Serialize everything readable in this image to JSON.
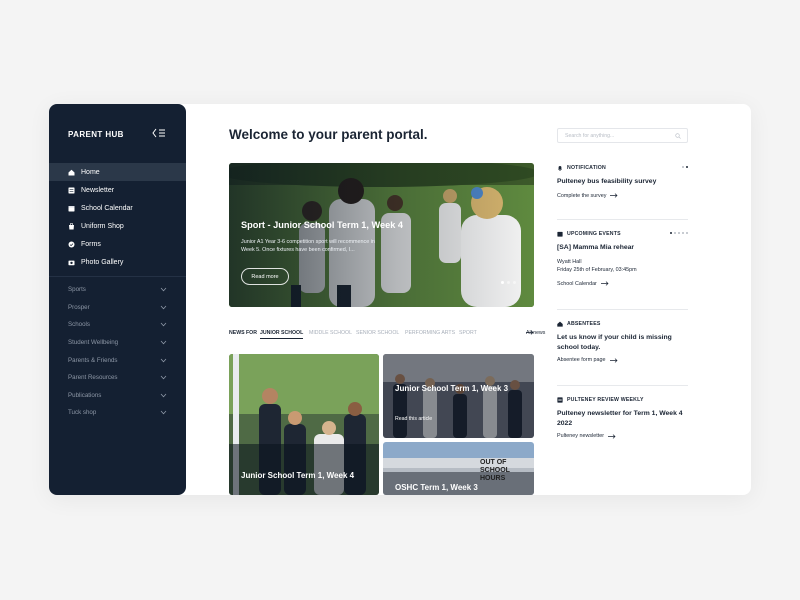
{
  "sidebar": {
    "brand": "PARENT HUB",
    "nav": [
      {
        "label": "Home",
        "icon": "home-icon"
      },
      {
        "label": "Newsletter",
        "icon": "newsletter-icon"
      },
      {
        "label": "School Calendar",
        "icon": "calendar-icon"
      },
      {
        "label": "Uniform Shop",
        "icon": "shop-icon"
      },
      {
        "label": "Forms",
        "icon": "forms-icon"
      },
      {
        "label": "Photo Gallery",
        "icon": "camera-icon"
      }
    ],
    "sections": [
      "Sports",
      "Prosper",
      "Schools",
      "Student Wellbeing",
      "Parents & Friends",
      "Parent Resources",
      "Publications",
      "Tuck shop"
    ]
  },
  "main": {
    "title": "Welcome to your parent portal.",
    "hero": {
      "title": "Sport - Junior School Term 1, Week 4",
      "text": "Junior A1 Year 3-6 competition sport will recommence in Week 5. Once fixtures have been confirmed, I...",
      "button": "Read more"
    },
    "tabs": {
      "lead": "NEWS FOR",
      "items": [
        "JUNIOR SCHOOL",
        "MIDDLE SCHOOL",
        "SENIOR SCHOOL",
        "PERFORMING ARTS",
        "SPORT"
      ],
      "all": "All news"
    },
    "cards": [
      {
        "title": "Junior School Term 1, Week 4"
      },
      {
        "title": "Junior School Term 1, Week 3",
        "link": "Read this article"
      },
      {
        "title": "OSHC Term 1, Week 3",
        "sign": "OUT OF SCHOOL HOURS"
      }
    ]
  },
  "right": {
    "search_placeholder": "Search for anything...",
    "notification": {
      "head": "NOTIFICATION",
      "title": "Pulteney bus feasibility survey",
      "link": "Complete the survey"
    },
    "events": {
      "head": "UPCOMING EVENTS",
      "title": "[SA] Mamma Mia rehear",
      "place": "Wyatt Hall",
      "time": "Friday 25th of February, 03:45pm",
      "link": "School Calendar"
    },
    "absentees": {
      "head": "ABSENTEES",
      "title": "Let us know if your child is missing school today.",
      "link": "Absentee form page"
    },
    "review": {
      "head": "PULTENEY REVIEW WEEKLY",
      "title": "Pulteney newsletter for Term 1, Week 4 2022",
      "link": "Pulteney newsletter"
    }
  },
  "colors": {
    "sidebar": "#142032",
    "active": "#2b3849",
    "text": "#1b2534",
    "muted": "#8d97a6"
  }
}
